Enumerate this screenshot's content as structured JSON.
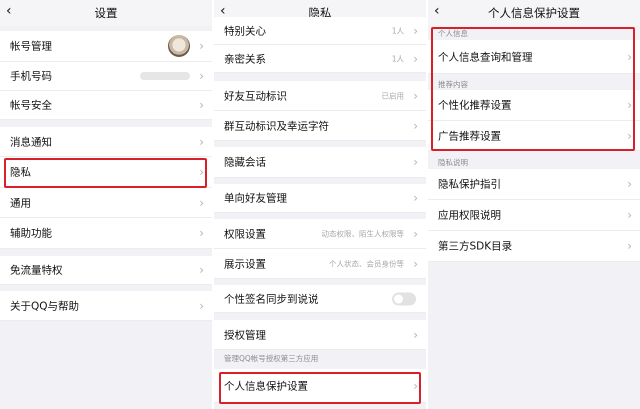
{
  "panels": {
    "settings": {
      "back_icon": "chevron-left-icon",
      "title": "设置",
      "items": [
        {
          "label": "帐号管理"
        },
        {
          "label": "手机号码",
          "value": ""
        },
        {
          "label": "帐号安全"
        },
        {
          "label": "消息通知"
        },
        {
          "label": "隐私"
        },
        {
          "label": "通用"
        },
        {
          "label": "辅助功能"
        },
        {
          "label": "免流量特权"
        },
        {
          "label": "关于QQ与帮助"
        }
      ]
    },
    "privacy": {
      "back_icon": "chevron-left-icon",
      "title": "隐私",
      "items": [
        {
          "label": "特别关心",
          "value": "1人"
        },
        {
          "label": "亲密关系",
          "value": "1人"
        },
        {
          "label": "好友互动标识",
          "value": "已启用"
        },
        {
          "label": "群互动标识及幸运字符",
          "value": ""
        },
        {
          "label": "隐藏会话",
          "value": ""
        },
        {
          "label": "单向好友管理",
          "value": ""
        },
        {
          "label": "权限设置",
          "value": "动态权限、陌生人权限等"
        },
        {
          "label": "展示设置",
          "value": "个人状态、会员身份等"
        },
        {
          "label": "个性签名同步到说说",
          "value": ""
        },
        {
          "label": "授权管理",
          "value": ""
        },
        {
          "label": "个人信息保护设置",
          "value": ""
        }
      ],
      "caption": "管理QQ帐号授权第三方应用",
      "toggle_on": false
    },
    "info_protection": {
      "back_icon": "chevron-left-icon",
      "title": "个人信息保护设置",
      "sections": [
        {
          "caption": "个人信息",
          "items": [
            {
              "label": "个人信息查询和管理"
            }
          ]
        },
        {
          "caption": "推荐内容",
          "items": [
            {
              "label": "个性化推荐设置"
            },
            {
              "label": "广告推荐设置"
            }
          ]
        },
        {
          "caption": "隐私说明",
          "items": [
            {
              "label": "隐私保护指引"
            },
            {
              "label": "应用权限说明"
            },
            {
              "label": "第三方SDK目录"
            }
          ]
        }
      ]
    }
  },
  "colors": {
    "highlight": "#d8202a",
    "background": "#f2f2f6",
    "row": "#ffffff"
  }
}
